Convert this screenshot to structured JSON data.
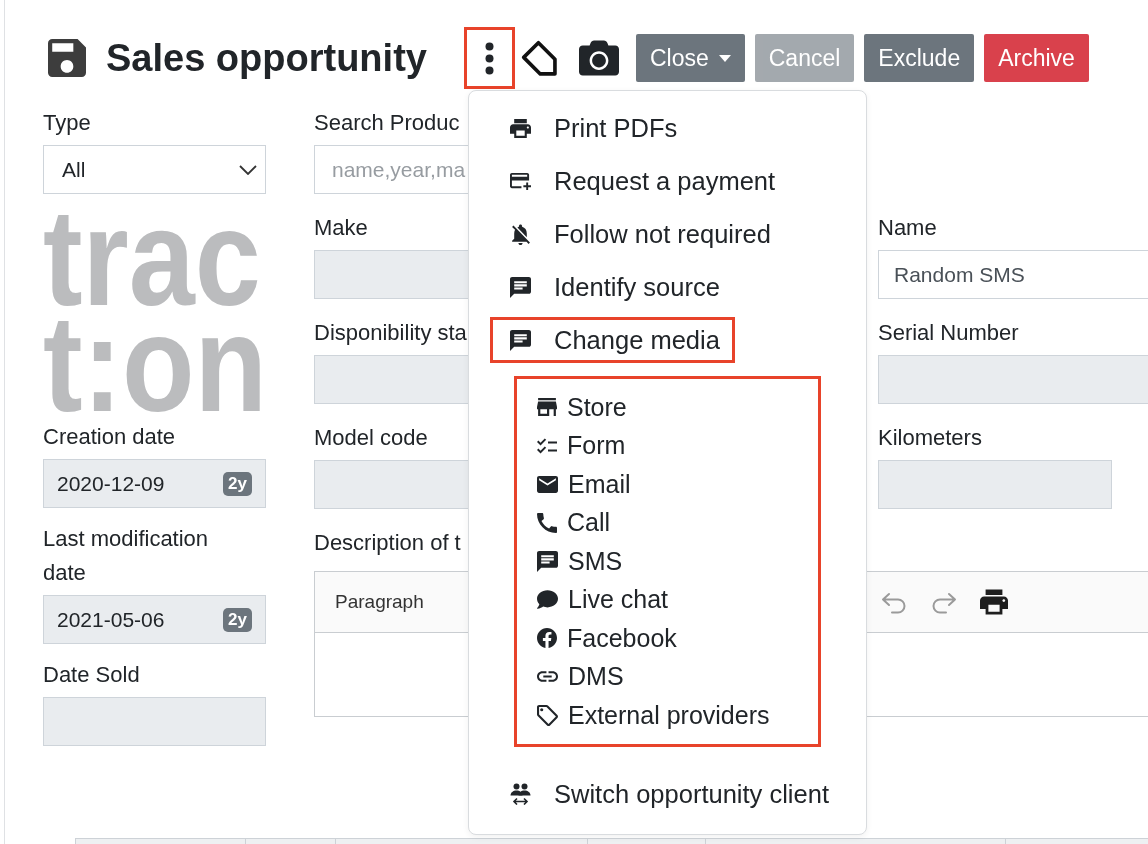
{
  "header": {
    "title": "Sales opportunity",
    "menu_button": {
      "highlighted": true
    },
    "buttons": [
      {
        "label": "Close",
        "kind": "menu",
        "disabled": false
      },
      {
        "label": "Cancel",
        "kind": "standard",
        "disabled": true
      },
      {
        "label": "Exclude",
        "kind": "standard",
        "disabled": false
      },
      {
        "label": "Archive",
        "kind": "destructive",
        "disabled": false
      }
    ]
  },
  "left_column": [
    {
      "kind": "select",
      "label": "Type",
      "value": "All"
    },
    {
      "kind": "logo",
      "lines": [
        "trac",
        "t:on"
      ]
    },
    {
      "kind": "date",
      "label": "Creation date",
      "value": "2020-12-09",
      "badge": "2y"
    },
    {
      "kind": "date",
      "label": "Last modification date",
      "value": "2021-05-06",
      "badge": "2y"
    },
    {
      "kind": "readonly",
      "label": "Date Sold"
    }
  ],
  "middle_column": [
    {
      "kind": "search",
      "label": "Search Produc",
      "placeholder": "name,year,ma"
    },
    {
      "kind": "readonly",
      "label": "Make"
    },
    {
      "kind": "readonly",
      "label": "Disponibility sta"
    },
    {
      "kind": "readonly",
      "label": "Model code"
    }
  ],
  "right_column": [
    {
      "kind": "text",
      "label": "Name",
      "value": "Random SMS"
    },
    {
      "kind": "readonly",
      "label": "Serial Number"
    },
    {
      "kind": "number",
      "label": "Kilometers"
    }
  ],
  "description_editor": {
    "label": "Description of t",
    "block_style": "Paragraph",
    "toolbar_buttons": [
      {
        "kind": "undo",
        "disabled": true
      },
      {
        "kind": "redo",
        "disabled": true
      },
      {
        "kind": "print",
        "disabled": false
      }
    ]
  },
  "actions_menu": {
    "items": [
      {
        "label": "Print PDFs",
        "highlighted": false
      },
      {
        "label": "Request a payment",
        "highlighted": false
      },
      {
        "label": "Follow not required",
        "highlighted": false
      },
      {
        "label": "Identify source",
        "highlighted": false
      },
      {
        "label": "Change media",
        "highlighted": true,
        "submenu": {
          "highlighted": true,
          "items": [
            "Store",
            "Form",
            "Email",
            "Call",
            "SMS",
            "Live chat",
            "Facebook",
            "DMS",
            "External providers"
          ]
        }
      },
      {
        "label": "Switch opportunity client",
        "highlighted": false
      }
    ]
  }
}
